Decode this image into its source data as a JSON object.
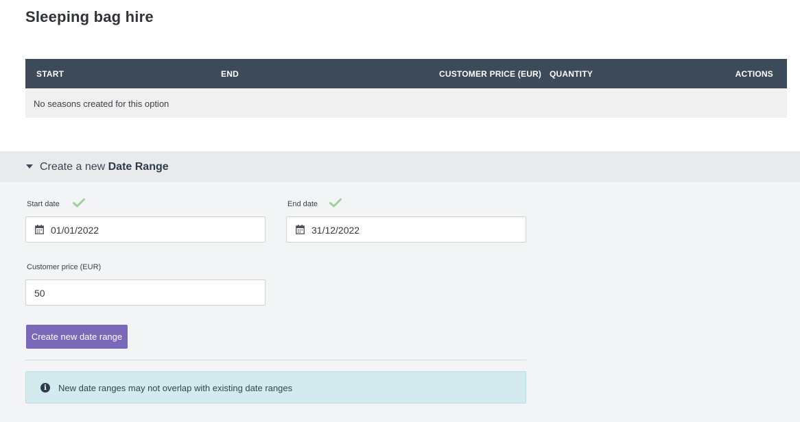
{
  "page": {
    "title": "Sleeping bag hire"
  },
  "table": {
    "headers": {
      "start": "START",
      "end": "END",
      "customer_price": "CUSTOMER PRICE (EUR)",
      "quantity": "QUANTITY",
      "actions": "ACTIONS"
    },
    "empty_message": "No seasons created for this option"
  },
  "create_section": {
    "title_prefix": "Create a new",
    "title_bold": "Date Range",
    "expanded": true,
    "start_date": {
      "label": "Start date",
      "value": "01/01/2022",
      "valid": true
    },
    "end_date": {
      "label": "End date",
      "value": "31/12/2022",
      "valid": true
    },
    "customer_price": {
      "label": "Customer price (EUR)",
      "value": "50"
    },
    "submit_label": "Create new date range",
    "info_message": "New date ranges may not overlap with existing date ranges"
  },
  "colors": {
    "header_bg": "#3d4a59",
    "button_bg": "#7b68b8",
    "check_color": "#9fcf9c",
    "alert_bg": "#d3ebef"
  },
  "icons": [
    "calendar-icon",
    "check-icon",
    "caret-down-icon",
    "info-icon"
  ]
}
